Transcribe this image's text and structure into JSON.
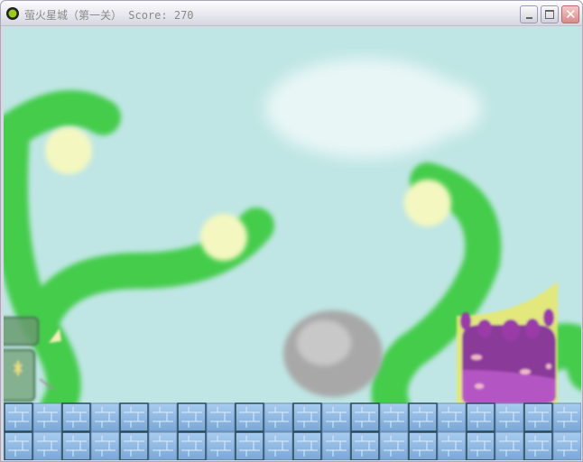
{
  "window": {
    "title": "萤火星城（第一关）",
    "score_label": "Score:",
    "score": "270",
    "buttons": {
      "minimize": "minimize",
      "maximize": "maximize",
      "close": "close"
    }
  },
  "colors": {
    "sky": "#bfe6e4",
    "vine": "#3fcb4a",
    "glow": "#f4f8c0",
    "tile": "#8fb8e0",
    "monster": "#a040b0"
  }
}
